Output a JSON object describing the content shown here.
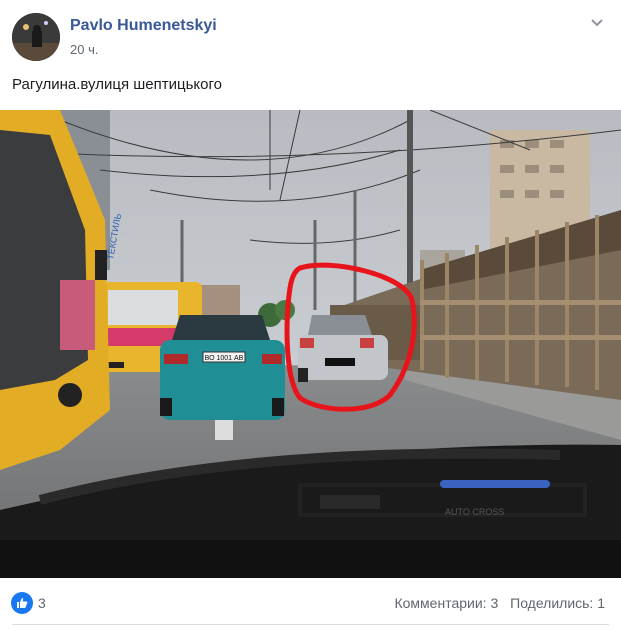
{
  "post": {
    "author": "Pavlo Humenetskyi",
    "time": "20 ч.",
    "text": "Рагулина.вулиця шептицького"
  },
  "photo": {
    "bus_ad_text": "ТЕКСТИЛЬ",
    "car_plate": "ВО 1001 АВ",
    "windshield_sticker": "AUTO CROSS"
  },
  "footer": {
    "like_count": "3",
    "comments": "Комментарии: 3",
    "shares": "Поделились: 1"
  },
  "icons": {
    "like": "thumbs-up-icon",
    "menu": "chevron-down-icon"
  },
  "colors": {
    "link": "#385898",
    "like_blue": "#1877f2",
    "annotation_red": "#e8141c"
  }
}
